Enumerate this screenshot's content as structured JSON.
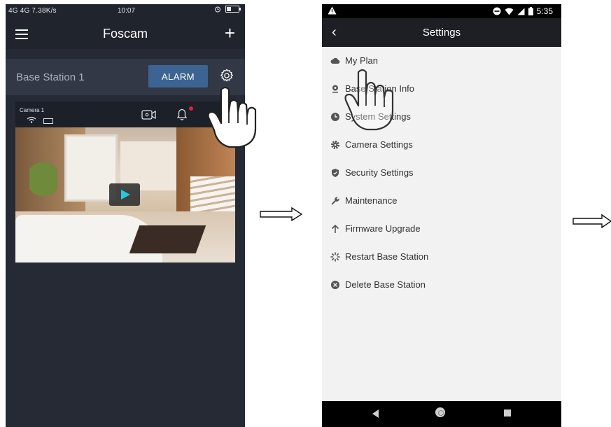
{
  "phone1": {
    "status": {
      "signal_text": "4G 4G 7.38K/s",
      "time": "10:07"
    },
    "header": {
      "title": "Foscam",
      "add_label": "+"
    },
    "station": {
      "name": "Base Station 1",
      "alarm_label": "ALARM"
    },
    "camera": {
      "label": "Camera 1"
    }
  },
  "phone2": {
    "status": {
      "time": "5:35"
    },
    "header": {
      "back_label": "‹",
      "title": "Settings"
    },
    "settings_items": [
      {
        "label": "My Plan",
        "icon": "cloud-icon"
      },
      {
        "label": "Base Station Info",
        "icon": "base-station-icon"
      },
      {
        "label": "System Settings",
        "icon": "clock-icon"
      },
      {
        "label": "Camera Settings",
        "icon": "gear-icon"
      },
      {
        "label": "Security Settings",
        "icon": "shield-icon"
      },
      {
        "label": "Maintenance",
        "icon": "wrench-icon"
      },
      {
        "label": "Firmware Upgrade",
        "icon": "arrow-up-icon"
      },
      {
        "label": "Restart Base Station",
        "icon": "spinner-icon"
      },
      {
        "label": "Delete Base Station",
        "icon": "delete-circle-icon"
      }
    ]
  },
  "colors": {
    "alarm_button": "#3b6492",
    "notification_dot": "#e0243a",
    "play_icon": "#22c9e0"
  }
}
